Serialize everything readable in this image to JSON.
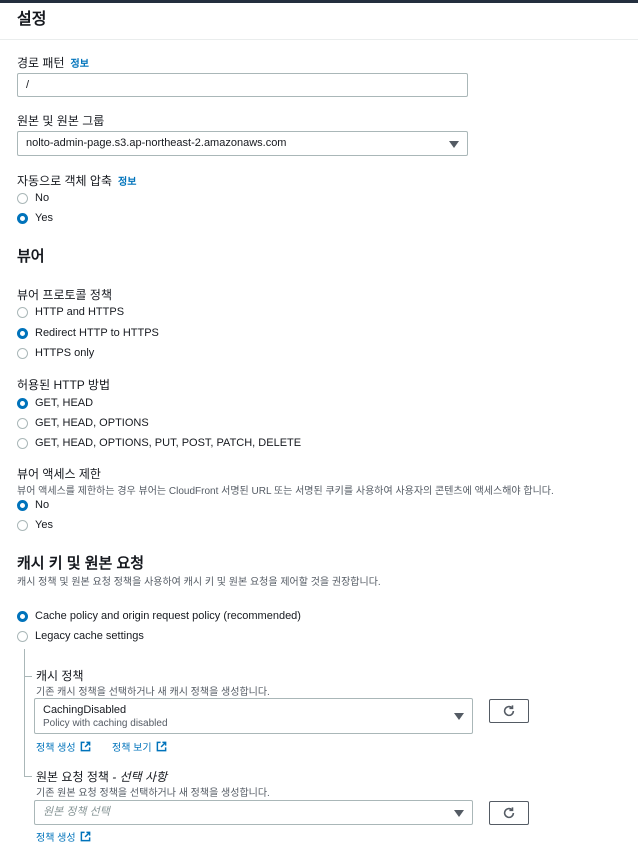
{
  "settings": {
    "title": "설정"
  },
  "path_pattern": {
    "label": "경로 패턴",
    "info": "정보",
    "value": "/"
  },
  "origin": {
    "label": "원본 및 원본 그룹",
    "value": "nolto-admin-page.s3.ap-northeast-2.amazonaws.com"
  },
  "compress": {
    "label": "자동으로 객체 압축",
    "info": "정보",
    "options": [
      "No",
      "Yes"
    ],
    "selected": "Yes"
  },
  "viewer": {
    "title": "뷰어"
  },
  "protocol_policy": {
    "label": "뷰어 프로토콜 정책",
    "options": [
      "HTTP and HTTPS",
      "Redirect HTTP to HTTPS",
      "HTTPS only"
    ],
    "selected": "Redirect HTTP to HTTPS"
  },
  "http_methods": {
    "label": "허용된 HTTP 방법",
    "options": [
      "GET, HEAD",
      "GET, HEAD, OPTIONS",
      "GET, HEAD, OPTIONS, PUT, POST, PATCH, DELETE"
    ],
    "selected": "GET, HEAD"
  },
  "access_restrict": {
    "label": "뷰어 액세스 제한",
    "description": "뷰어 액세스를 제한하는 경우 뷰어는 CloudFront 서명된 URL 또는 서명된 쿠키를 사용하여 사용자의 콘텐츠에 액세스해야 합니다.",
    "options": [
      "No",
      "Yes"
    ],
    "selected": "No"
  },
  "cache_key": {
    "title": "캐시 키 및 원본 요청",
    "description": "캐시 정책 및 원본 요청 정책을 사용하여 캐시 키 및 원본 요청을 제어할 것을 권장합니다.",
    "options": [
      "Cache policy and origin request policy (recommended)",
      "Legacy cache settings"
    ],
    "selected": "Cache policy and origin request policy (recommended)"
  },
  "cache_policy": {
    "label": "캐시 정책",
    "description": "기존 캐시 정책을 선택하거나 새 캐시 정책을 생성합니다.",
    "selected_name": "CachingDisabled",
    "selected_desc": "Policy with caching disabled",
    "create_link": "정책 생성",
    "view_link": "정책 보기"
  },
  "origin_request_policy": {
    "label": "원본 요청 정책",
    "label_suffix": " - 선택 사항",
    "description": "기존 원본 요청 정책을 선택하거나 새 정책을 생성합니다.",
    "placeholder": "원본 정책 선택",
    "create_link": "정책 생성"
  },
  "colors": {
    "accent": "#0073bb",
    "text": "#16191f",
    "border": "#aab7b8"
  },
  "icons": {
    "refresh": "refresh-icon",
    "external": "external-link-icon",
    "caret": "caret-down-icon"
  }
}
